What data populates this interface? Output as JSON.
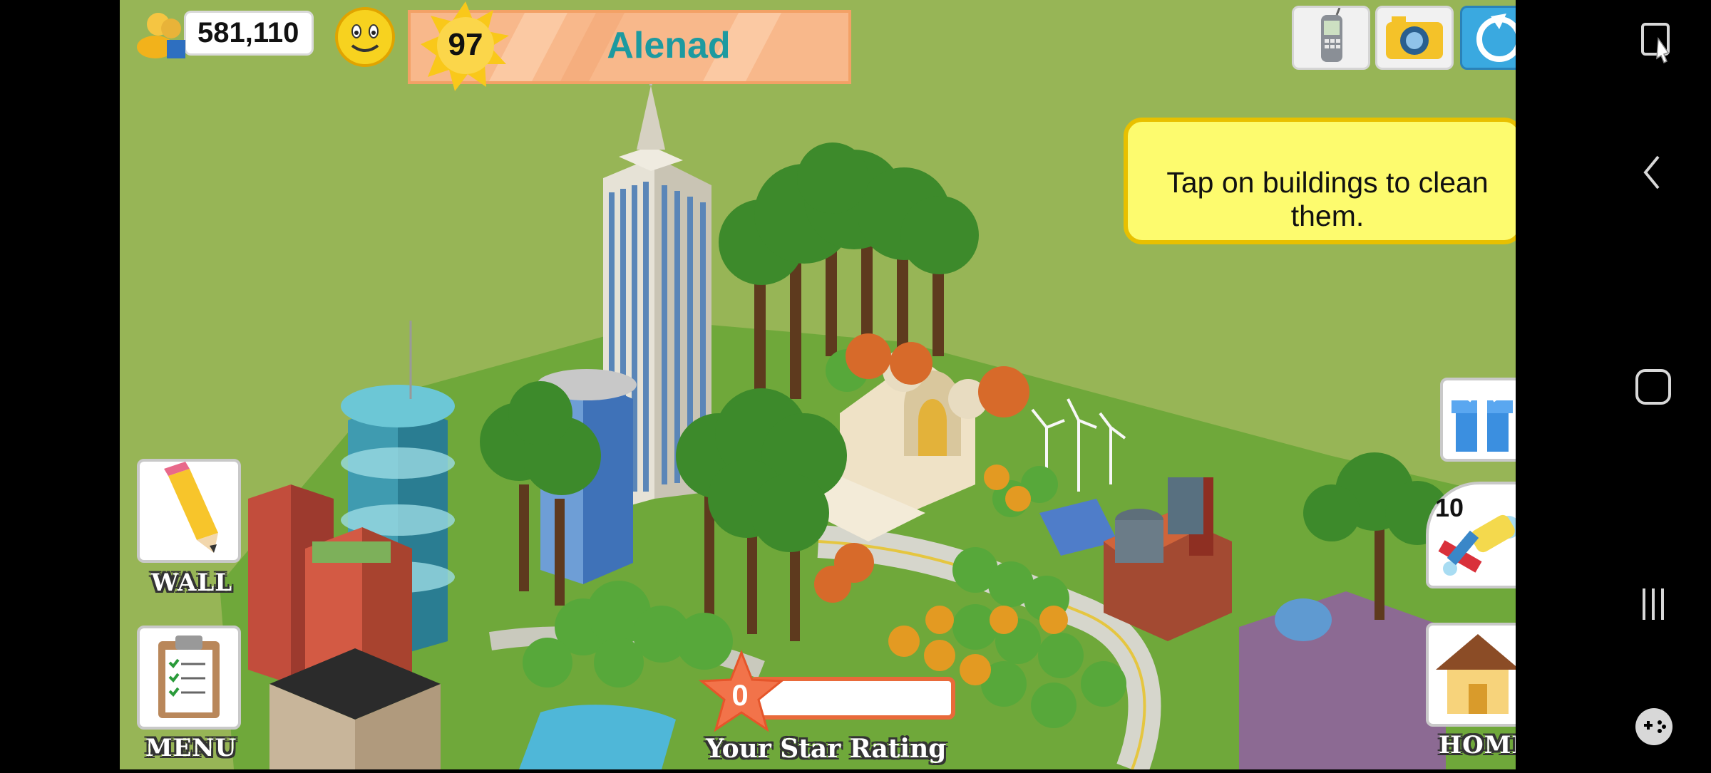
{
  "hud": {
    "coins": "581,110",
    "level": "97",
    "player_name": "Alenad"
  },
  "tip": {
    "text": "Tap on buildings to clean them."
  },
  "buttons": {
    "wall_label": "WALL",
    "menu_label": "MENU",
    "home_label": "HOME",
    "cleaning_count": "10"
  },
  "star_rating": {
    "value": "0",
    "label": "Your Star Rating"
  },
  "top_icons": [
    "phone-icon",
    "camera-icon",
    "social-icon"
  ],
  "colors": {
    "grass": "#97b556",
    "tip_background": "#fdfb6e",
    "level_bar": "#f8b88b",
    "name_text": "#1d9aa0"
  }
}
